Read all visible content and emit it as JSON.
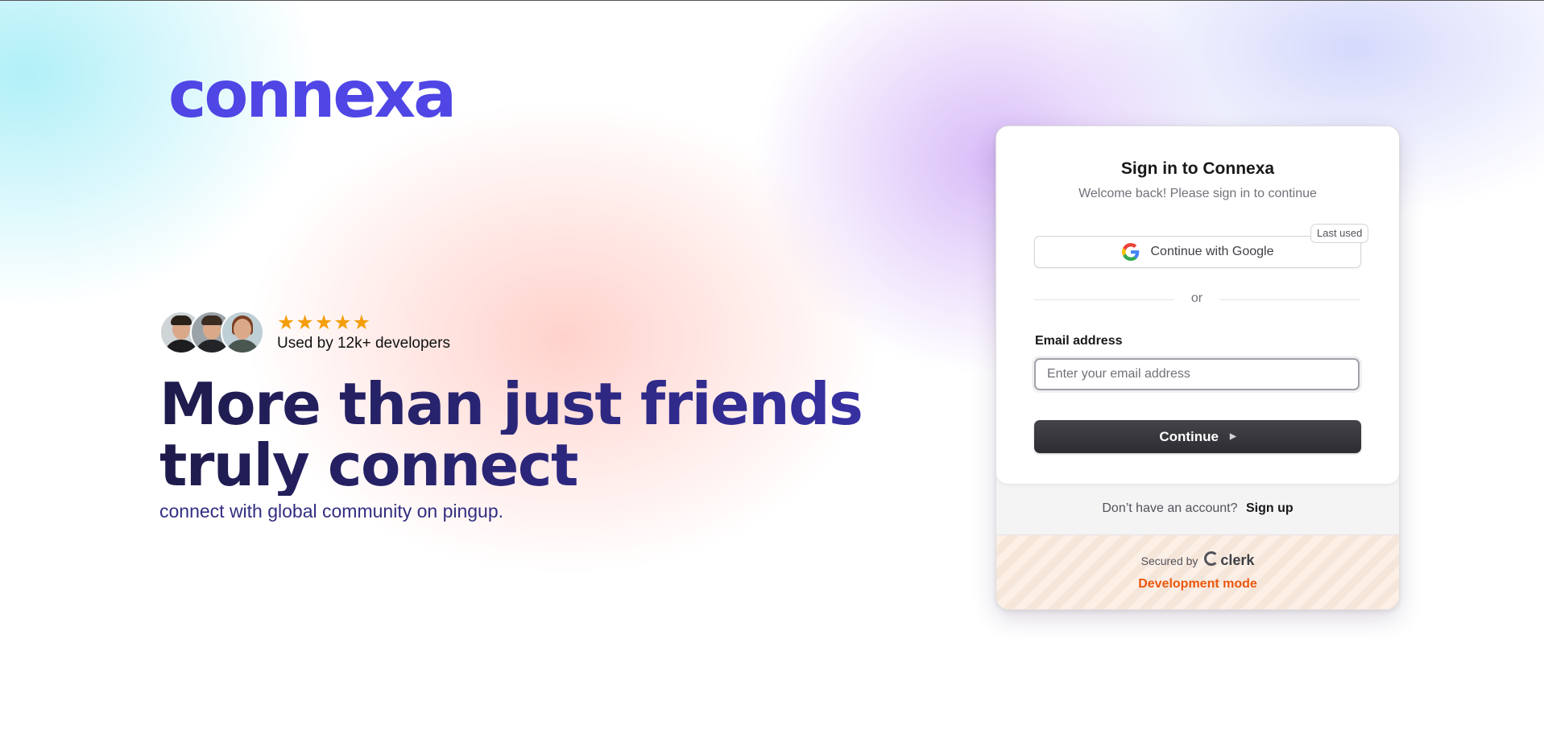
{
  "brand": {
    "logo_text": "connexa"
  },
  "hero": {
    "rating_stars": 5,
    "stars_text": "★★★★★",
    "usage_text": "Used by 12k+ developers",
    "headline_line1": "More than just friends",
    "headline_line2": "truly connect",
    "subline": "connect with global community on pingup."
  },
  "signin": {
    "title": "Sign in to Connexa",
    "subtitle": "Welcome back! Please sign in to continue",
    "google_label": "Continue with Google",
    "last_used_badge": "Last used",
    "divider_text": "or",
    "email_label": "Email address",
    "email_value": "",
    "email_placeholder": "Enter your email address",
    "continue_label": "Continue",
    "no_account_text": "Don’t have an account?",
    "signup_label": "Sign up",
    "secured_by": "Secured by",
    "provider": "clerk",
    "dev_mode": "Development mode"
  },
  "colors": {
    "brand": "#4f46e5",
    "headline": "#1e1b4b",
    "star": "#f59e0b",
    "primary_button": "#2f2f34",
    "dev_mode": "#ea580c"
  },
  "icons": [
    "google-icon",
    "star-icon",
    "play-arrow-icon",
    "clerk-logo-icon"
  ]
}
